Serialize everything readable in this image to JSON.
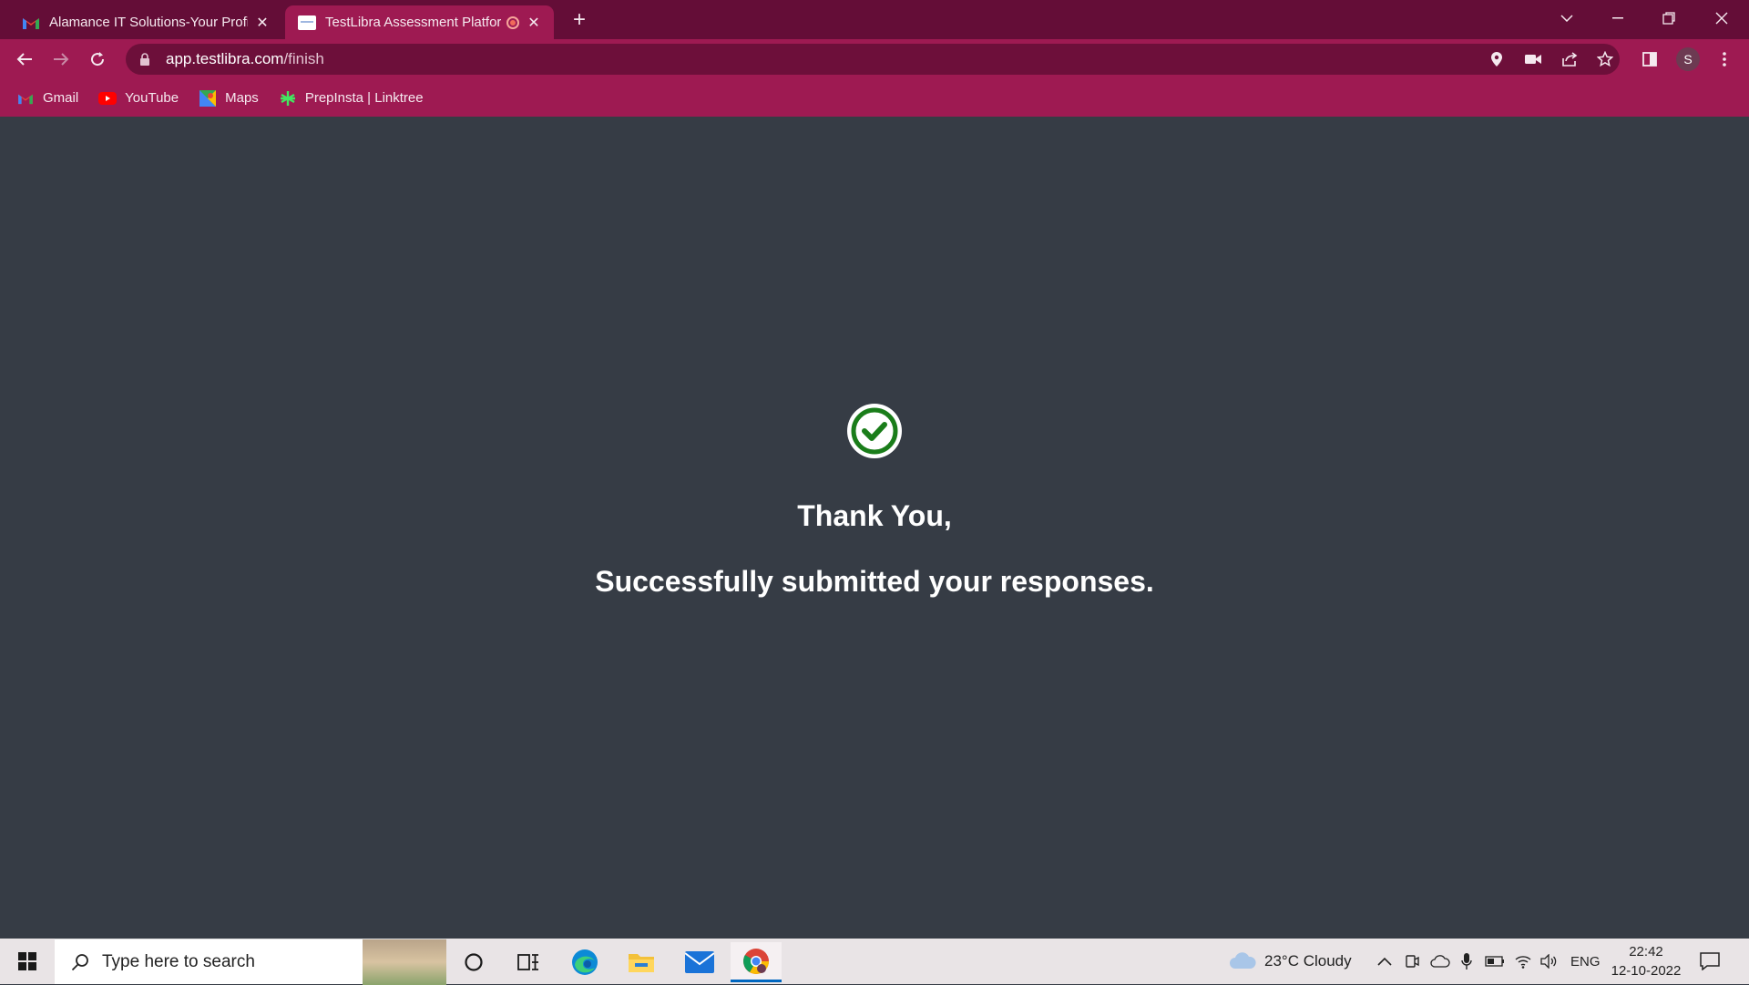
{
  "browser": {
    "tabs": [
      {
        "title": "Alamance IT Solutions-Your Profi",
        "active": false,
        "icon": "gmail-icon"
      },
      {
        "title": "TestLibra Assessment Platforr",
        "active": true,
        "icon": "testlibra-icon",
        "recording": true
      }
    ],
    "url": {
      "host": "app.testlibra.com",
      "path": "/finish"
    },
    "profile_initial": "S",
    "colors": {
      "frame": "#640d37",
      "toolbar": "#9e1a52",
      "omnibox": "#6d0f3a"
    }
  },
  "bookmarks": [
    {
      "label": "Gmail",
      "icon": "gmail-icon"
    },
    {
      "label": "YouTube",
      "icon": "youtube-icon"
    },
    {
      "label": "Maps",
      "icon": "maps-icon"
    },
    {
      "label": "PrepInsta | Linktree",
      "icon": "linktree-icon"
    }
  ],
  "page": {
    "heading": "Thank You,",
    "message": "Successfully submitted your responses.",
    "status_icon": "check-circle-icon",
    "colors": {
      "background": "#363c45",
      "check": "#1a7d1a"
    }
  },
  "taskbar": {
    "search_placeholder": "Type here to search",
    "weather": "23°C  Cloudy",
    "language": "ENG",
    "time": "22:42",
    "date": "12-10-2022"
  }
}
